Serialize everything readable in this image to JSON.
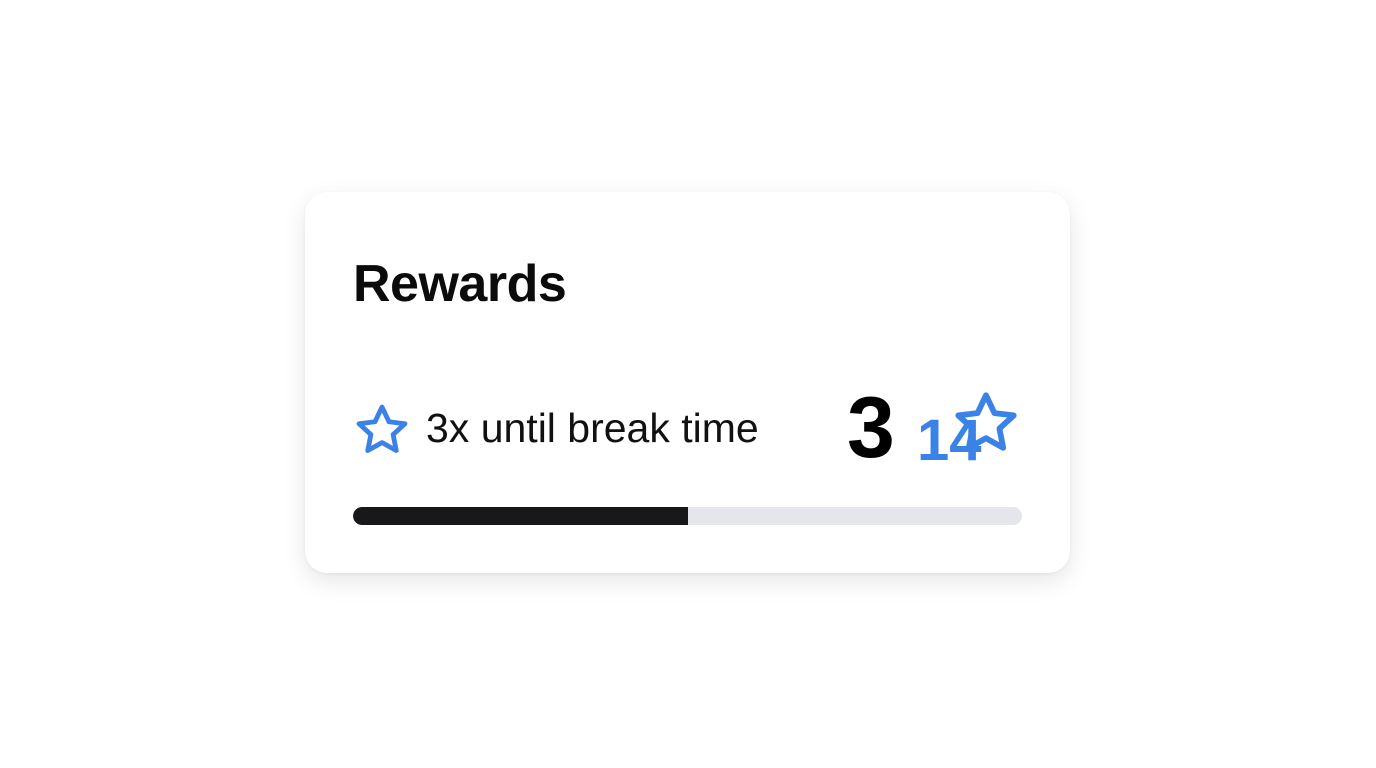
{
  "card": {
    "title": "Rewards"
  },
  "rewards": {
    "label": "3x until break time",
    "count": "3",
    "total": "14",
    "progress_fraction": 0.5
  },
  "icons": {
    "left": "star-outline-icon",
    "right": "star-outline-icon"
  },
  "colors": {
    "accent": "#3b82e6",
    "progress_fill": "#18181b",
    "progress_track": "#e5e6eb"
  }
}
